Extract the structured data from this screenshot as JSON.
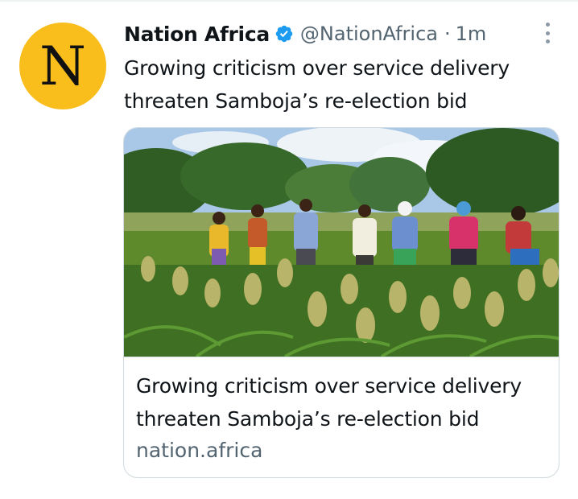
{
  "account": {
    "avatar_letter": "N",
    "avatar_color": "#f9bd1c",
    "name": "Nation Africa",
    "verified": true,
    "handle": "@NationAfrica",
    "separator": "·",
    "time": "1m"
  },
  "tweet": {
    "text": "Growing criticism over service delivery threaten Samboja’s re-election bid"
  },
  "link_card": {
    "image_icon": "photo-farmers-sorghum-field",
    "title": "Growing criticism over service delivery threaten Samboja’s re-election bid",
    "domain": "nation.africa"
  },
  "icons": {
    "verified": "verified-badge-icon",
    "more": "more-options-icon"
  },
  "colors": {
    "verified_blue": "#1d9bf0",
    "secondary_text": "#536471"
  }
}
